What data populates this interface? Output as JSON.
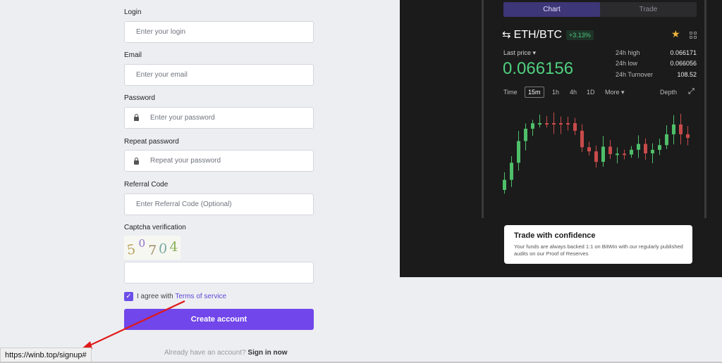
{
  "form": {
    "login": {
      "label": "Login",
      "placeholder": "Enter your login"
    },
    "email": {
      "label": "Email",
      "placeholder": "Enter your email"
    },
    "password": {
      "label": "Password",
      "placeholder": "Enter your password"
    },
    "repeat_password": {
      "label": "Repeat password",
      "placeholder": "Repeat your password"
    },
    "referral": {
      "label": "Referral Code",
      "placeholder": "Enter Referral Code (Optional)"
    },
    "captcha": {
      "label": "Captcha verification",
      "chars": [
        "5",
        "0",
        "7",
        "0",
        "4"
      ],
      "value": ""
    },
    "terms": {
      "prefix": "I agree with",
      "link": "Terms of service",
      "checked": true
    },
    "create_button": "Create account",
    "signin_prefix": "Already have an account?",
    "signin_link": "Sign in now"
  },
  "promo": {
    "tabs": [
      "Chart",
      "Trade"
    ],
    "pair": "ETH/BTC",
    "change": "+3.13%",
    "last_price_label": "Last price",
    "last_price": "0.066156",
    "stats": [
      {
        "key": "24h high",
        "value": "0.066171"
      },
      {
        "key": "24h low",
        "value": "0.066056"
      },
      {
        "key": "24h Turnover",
        "value": "108.52"
      }
    ],
    "timeframes": [
      "Time",
      "15m",
      "1h",
      "4h",
      "1D",
      "More"
    ],
    "selected_timeframe": "15m",
    "depth": "Depth",
    "card_title": "Trade with confidence",
    "card_text": "Your funds are always backed 1:1 on BitWin with our regularly published audits on our Proof of Reserves",
    "colors": {
      "up": "#4fbf6a",
      "down": "#c94a4a",
      "accent": "#7146ea"
    }
  },
  "status_url": "https://winb.top/signup#"
}
